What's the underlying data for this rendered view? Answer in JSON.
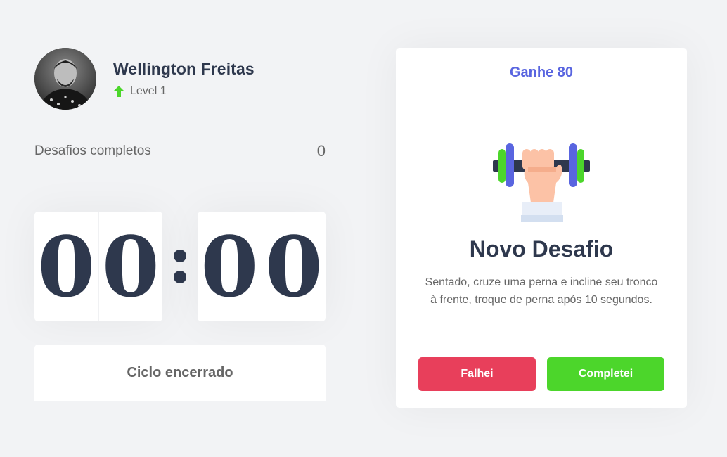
{
  "profile": {
    "name": "Wellington Freitas",
    "level_label": "Level 1",
    "level_icon": "arrow-up-icon",
    "level_color": "#4cd62b"
  },
  "challenges": {
    "label": "Desafios completos",
    "count": "0"
  },
  "countdown": {
    "minute_left": "0",
    "minute_right": "0",
    "separator": ":",
    "second_left": "0",
    "second_right": "0"
  },
  "cycle_button": {
    "label": "Ciclo encerrado"
  },
  "challenge_card": {
    "header": "Ganhe 80",
    "icon": "dumbbell-hand-icon",
    "title": "Novo Desafio",
    "description": "Sentado, cruze uma perna e incline seu tronco à frente, troque de perna após 10 segundos.",
    "fail_label": "Falhei",
    "success_label": "Completei"
  },
  "colors": {
    "background": "#f2f3f5",
    "title": "#2e384d",
    "text": "#666666",
    "accent": "#5965e0",
    "fail": "#e83f5b",
    "success": "#4cd62b"
  }
}
